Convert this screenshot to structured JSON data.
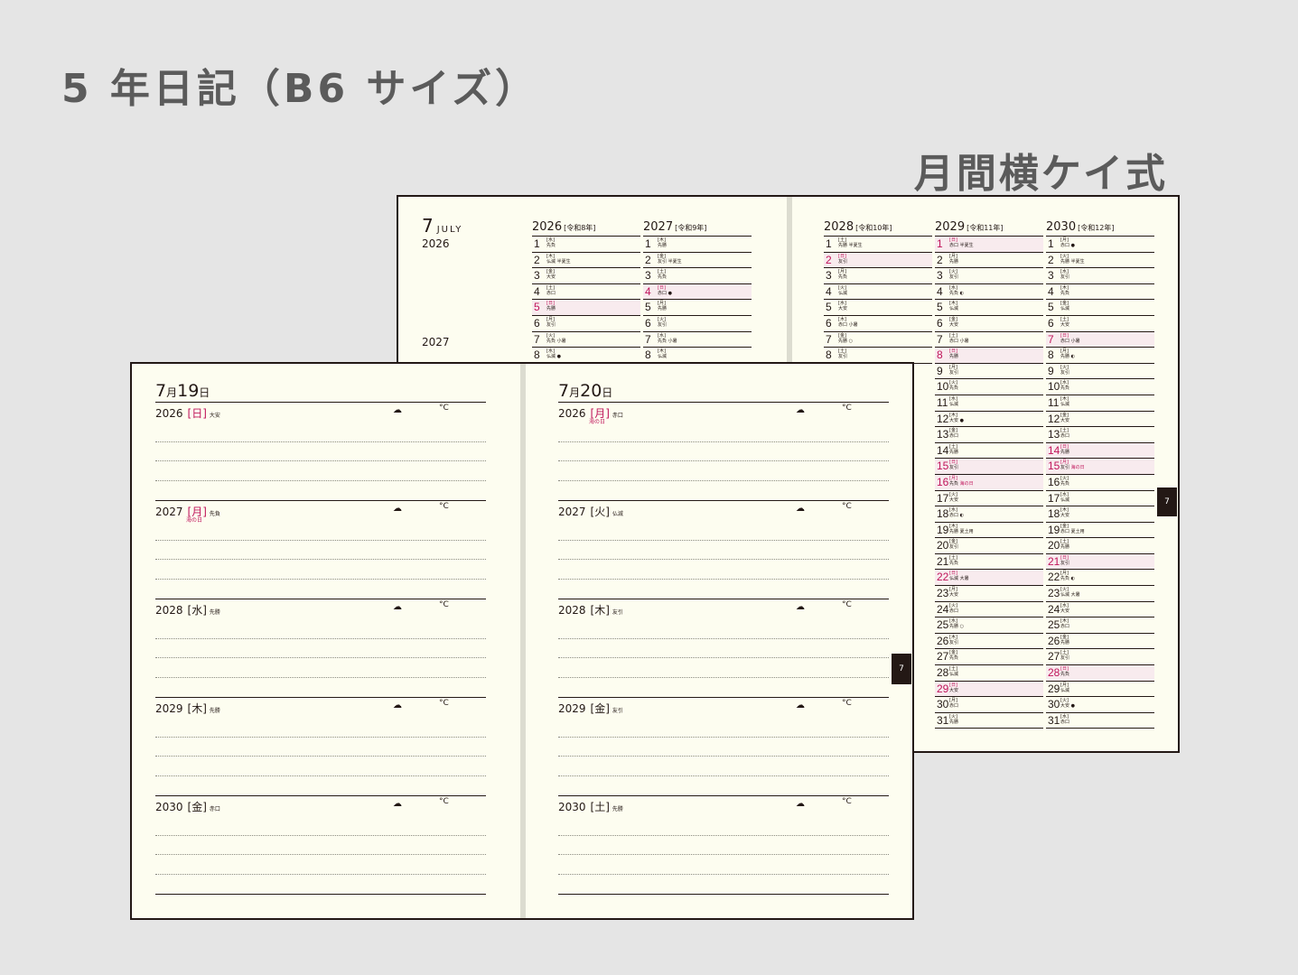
{
  "title": "5 年日記（B6 サイズ）",
  "subtitle": "月間横ケイ式",
  "monthly": {
    "month_num": "7",
    "month_en": "JULY",
    "year_labels": [
      "2026",
      "2027"
    ],
    "left_cols": [
      {
        "year": "2026",
        "era": "[令和8年]",
        "days": [
          {
            "d": "1",
            "w": "[水]",
            "r": "先負",
            "x": ""
          },
          {
            "d": "2",
            "w": "[木]",
            "r": "仏滅",
            "x": "半夏生"
          },
          {
            "d": "3",
            "w": "[金]",
            "r": "大安",
            "x": ""
          },
          {
            "d": "4",
            "w": "[土]",
            "r": "赤口",
            "x": ""
          },
          {
            "d": "5",
            "w": "[日]",
            "r": "先勝",
            "x": "",
            "red": true,
            "hol": true
          },
          {
            "d": "6",
            "w": "[月]",
            "r": "友引",
            "x": ""
          },
          {
            "d": "7",
            "w": "[火]",
            "r": "先負",
            "x": "小暑"
          },
          {
            "d": "8",
            "w": "[水]",
            "r": "仏滅",
            "x": "●"
          }
        ]
      },
      {
        "year": "2027",
        "era": "[令和9年]",
        "days": [
          {
            "d": "1",
            "w": "[木]",
            "r": "先勝",
            "x": ""
          },
          {
            "d": "2",
            "w": "[金]",
            "r": "友引",
            "x": "半夏生"
          },
          {
            "d": "3",
            "w": "[土]",
            "r": "先負",
            "x": ""
          },
          {
            "d": "4",
            "w": "[日]",
            "r": "赤口",
            "x": "●",
            "red": true,
            "hol": true
          },
          {
            "d": "5",
            "w": "[月]",
            "r": "先勝",
            "x": ""
          },
          {
            "d": "6",
            "w": "[火]",
            "r": "友引",
            "x": ""
          },
          {
            "d": "7",
            "w": "[水]",
            "r": "先負",
            "x": "小暑"
          },
          {
            "d": "8",
            "w": "[木]",
            "r": "仏滅",
            "x": ""
          }
        ]
      }
    ],
    "right_cols": [
      {
        "year": "2028",
        "era": "[令和10年]",
        "days": [
          {
            "d": "1",
            "w": "[土]",
            "r": "先勝",
            "x": "半夏生"
          },
          {
            "d": "2",
            "w": "[日]",
            "r": "友引",
            "x": "",
            "red": true,
            "hol": true
          },
          {
            "d": "3",
            "w": "[月]",
            "r": "先負",
            "x": ""
          },
          {
            "d": "4",
            "w": "[火]",
            "r": "仏滅",
            "x": ""
          },
          {
            "d": "5",
            "w": "[水]",
            "r": "大安",
            "x": ""
          },
          {
            "d": "6",
            "w": "[木]",
            "r": "赤口",
            "x": "小暑"
          },
          {
            "d": "7",
            "w": "[金]",
            "r": "先勝",
            "x": "○"
          },
          {
            "d": "8",
            "w": "[土]",
            "r": "友引",
            "x": ""
          }
        ]
      },
      {
        "year": "2029",
        "era": "[令和11年]",
        "days": [
          {
            "d": "1",
            "w": "[日]",
            "r": "赤口",
            "x": "半夏生",
            "red": true,
            "hol": true
          },
          {
            "d": "2",
            "w": "[月]",
            "r": "先勝",
            "x": ""
          },
          {
            "d": "3",
            "w": "[火]",
            "r": "友引",
            "x": ""
          },
          {
            "d": "4",
            "w": "[水]",
            "r": "先負",
            "x": "◐"
          },
          {
            "d": "5",
            "w": "[木]",
            "r": "仏滅",
            "x": ""
          },
          {
            "d": "6",
            "w": "[金]",
            "r": "大安",
            "x": ""
          },
          {
            "d": "7",
            "w": "[土]",
            "r": "赤口",
            "x": "小暑"
          },
          {
            "d": "8",
            "w": "[日]",
            "r": "先勝",
            "x": "",
            "red": true,
            "hol": true
          },
          {
            "d": "9",
            "w": "[月]",
            "r": "友引",
            "x": ""
          },
          {
            "d": "10",
            "w": "[火]",
            "r": "先負",
            "x": ""
          },
          {
            "d": "11",
            "w": "[水]",
            "r": "仏滅",
            "x": ""
          },
          {
            "d": "12",
            "w": "[木]",
            "r": "大安",
            "x": "●"
          },
          {
            "d": "13",
            "w": "[金]",
            "r": "赤口",
            "x": ""
          },
          {
            "d": "14",
            "w": "[土]",
            "r": "先勝",
            "x": ""
          },
          {
            "d": "15",
            "w": "[日]",
            "r": "友引",
            "x": "",
            "red": true,
            "hol": true
          },
          {
            "d": "16",
            "w": "[月]",
            "r": "先負",
            "x": "海の日",
            "red": true,
            "hol": true
          },
          {
            "d": "17",
            "w": "[火]",
            "r": "大安",
            "x": ""
          },
          {
            "d": "18",
            "w": "[水]",
            "r": "赤口",
            "x": "◐"
          },
          {
            "d": "19",
            "w": "[木]",
            "r": "先勝",
            "x": "夏土用"
          },
          {
            "d": "20",
            "w": "[金]",
            "r": "友引",
            "x": ""
          },
          {
            "d": "21",
            "w": "[土]",
            "r": "先負",
            "x": ""
          },
          {
            "d": "22",
            "w": "[日]",
            "r": "仏滅",
            "x": "大暑",
            "red": true,
            "hol": true
          },
          {
            "d": "23",
            "w": "[月]",
            "r": "大安",
            "x": ""
          },
          {
            "d": "24",
            "w": "[火]",
            "r": "赤口",
            "x": ""
          },
          {
            "d": "25",
            "w": "[水]",
            "r": "先勝",
            "x": "○"
          },
          {
            "d": "26",
            "w": "[木]",
            "r": "友引",
            "x": ""
          },
          {
            "d": "27",
            "w": "[金]",
            "r": "先負",
            "x": ""
          },
          {
            "d": "28",
            "w": "[土]",
            "r": "仏滅",
            "x": ""
          },
          {
            "d": "29",
            "w": "[日]",
            "r": "大安",
            "x": "",
            "red": true,
            "hol": true
          },
          {
            "d": "30",
            "w": "[月]",
            "r": "赤口",
            "x": ""
          },
          {
            "d": "31",
            "w": "[火]",
            "r": "先勝",
            "x": ""
          }
        ]
      },
      {
        "year": "2030",
        "era": "[令和12年]",
        "days": [
          {
            "d": "1",
            "w": "[月]",
            "r": "赤口",
            "x": "●"
          },
          {
            "d": "2",
            "w": "[火]",
            "r": "先勝",
            "x": "半夏生"
          },
          {
            "d": "3",
            "w": "[水]",
            "r": "友引",
            "x": ""
          },
          {
            "d": "4",
            "w": "[木]",
            "r": "先負",
            "x": ""
          },
          {
            "d": "5",
            "w": "[金]",
            "r": "仏滅",
            "x": ""
          },
          {
            "d": "6",
            "w": "[土]",
            "r": "大安",
            "x": ""
          },
          {
            "d": "7",
            "w": "[日]",
            "r": "赤口",
            "x": "小暑",
            "red": true,
            "hol": true
          },
          {
            "d": "8",
            "w": "[月]",
            "r": "先勝",
            "x": "◐"
          },
          {
            "d": "9",
            "w": "[火]",
            "r": "友引",
            "x": ""
          },
          {
            "d": "10",
            "w": "[水]",
            "r": "先負",
            "x": ""
          },
          {
            "d": "11",
            "w": "[木]",
            "r": "仏滅",
            "x": ""
          },
          {
            "d": "12",
            "w": "[金]",
            "r": "大安",
            "x": ""
          },
          {
            "d": "13",
            "w": "[土]",
            "r": "赤口",
            "x": ""
          },
          {
            "d": "14",
            "w": "[日]",
            "r": "先勝",
            "x": "",
            "red": true,
            "hol": true
          },
          {
            "d": "15",
            "w": "[月]",
            "r": "友引",
            "x": "海の日",
            "red": true,
            "hol": true
          },
          {
            "d": "16",
            "w": "[火]",
            "r": "先負",
            "x": ""
          },
          {
            "d": "17",
            "w": "[水]",
            "r": "仏滅",
            "x": ""
          },
          {
            "d": "18",
            "w": "[木]",
            "r": "大安",
            "x": ""
          },
          {
            "d": "19",
            "w": "[金]",
            "r": "赤口",
            "x": "夏土用"
          },
          {
            "d": "20",
            "w": "[土]",
            "r": "先勝",
            "x": ""
          },
          {
            "d": "21",
            "w": "[日]",
            "r": "友引",
            "x": "",
            "red": true,
            "hol": true
          },
          {
            "d": "22",
            "w": "[月]",
            "r": "先負",
            "x": "◐"
          },
          {
            "d": "23",
            "w": "[火]",
            "r": "仏滅",
            "x": "大暑"
          },
          {
            "d": "24",
            "w": "[水]",
            "r": "大安",
            "x": ""
          },
          {
            "d": "25",
            "w": "[木]",
            "r": "赤口",
            "x": ""
          },
          {
            "d": "26",
            "w": "[金]",
            "r": "先勝",
            "x": ""
          },
          {
            "d": "27",
            "w": "[土]",
            "r": "友引",
            "x": ""
          },
          {
            "d": "28",
            "w": "[日]",
            "r": "先負",
            "x": "",
            "red": true,
            "hol": true
          },
          {
            "d": "29",
            "w": "[月]",
            "r": "仏滅",
            "x": ""
          },
          {
            "d": "30",
            "w": "[火]",
            "r": "大安",
            "x": "●"
          },
          {
            "d": "31",
            "w": "[水]",
            "r": "赤口",
            "x": ""
          }
        ]
      }
    ],
    "tab_label": "7"
  },
  "daily": {
    "tab_label": "7",
    "pages": [
      {
        "date": "7月19日",
        "num": "7",
        "unit1": "月",
        "day": "19",
        "unit2": "日",
        "years": [
          {
            "year": "2026",
            "weekday": "[日]",
            "rokuyo": "大安",
            "red": true,
            "holiday": ""
          },
          {
            "year": "2027",
            "weekday": "[月]",
            "rokuyo": "先負",
            "red": true,
            "holiday": "海の日"
          },
          {
            "year": "2028",
            "weekday": "[水]",
            "rokuyo": "先勝",
            "red": false,
            "holiday": ""
          },
          {
            "year": "2029",
            "weekday": "[木]",
            "rokuyo": "先勝",
            "red": false,
            "holiday": ""
          },
          {
            "year": "2030",
            "weekday": "[金]",
            "rokuyo": "赤口",
            "red": false,
            "holiday": ""
          }
        ]
      },
      {
        "date": "7月20日",
        "num": "7",
        "unit1": "月",
        "day": "20",
        "unit2": "日",
        "years": [
          {
            "year": "2026",
            "weekday": "[月]",
            "rokuyo": "赤口",
            "red": true,
            "holiday": "海の日"
          },
          {
            "year": "2027",
            "weekday": "[火]",
            "rokuyo": "仏滅",
            "red": false,
            "holiday": ""
          },
          {
            "year": "2028",
            "weekday": "[木]",
            "rokuyo": "友引",
            "red": false,
            "holiday": ""
          },
          {
            "year": "2029",
            "weekday": "[金]",
            "rokuyo": "友引",
            "red": false,
            "holiday": ""
          },
          {
            "year": "2030",
            "weekday": "[土]",
            "rokuyo": "先勝",
            "red": false,
            "holiday": ""
          }
        ]
      }
    ],
    "weather_icon": "cloud-sun-icon",
    "thermo_icon": "thermometer-icon",
    "weather_glyph": "☁",
    "thermo_glyph": "°C"
  },
  "colors": {
    "red": "#c0145a",
    "paper": "#fdfdf0",
    "ink": "#231815"
  }
}
